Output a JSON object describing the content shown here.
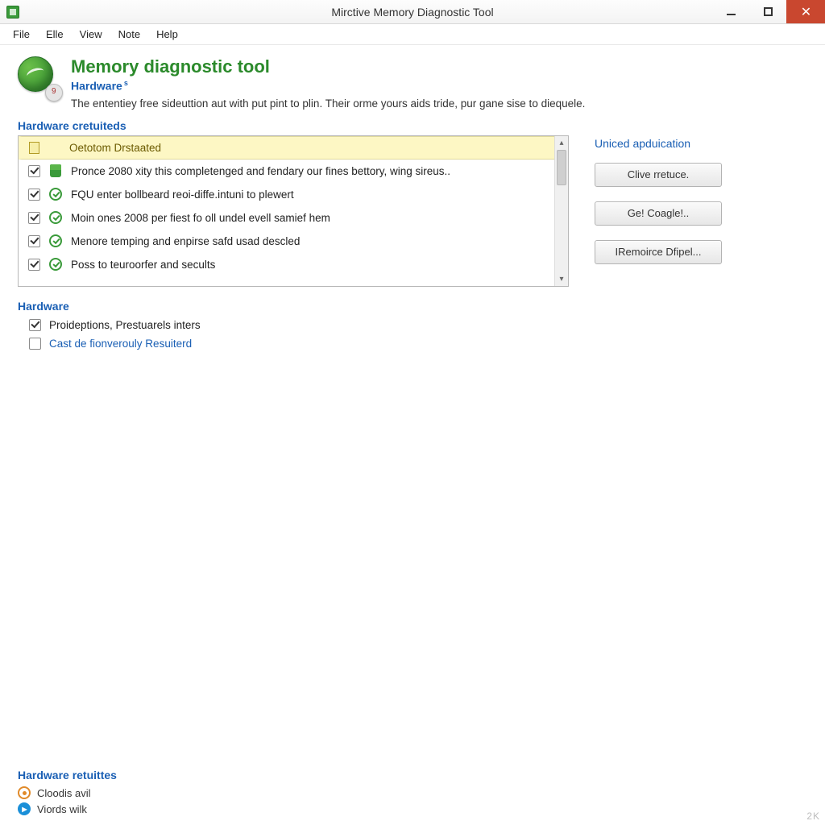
{
  "window": {
    "title": "Mirctive Memory Diagnostic Tool"
  },
  "menu": [
    "File",
    "Elle",
    "View",
    "Note",
    "Help"
  ],
  "header": {
    "title": "Memory diagnostic tool",
    "subtitle": "Hardware",
    "description": "The ententiey free sideuttion aut with put pint to plin. Their orme yours aids tride, pur gane sise to diequele."
  },
  "list": {
    "section_label": "Hardware cretuiteds",
    "items": [
      {
        "checked": false,
        "icon": "doc",
        "text": "Oetotom Drstaated",
        "header": true
      },
      {
        "checked": true,
        "icon": "shield",
        "text": "Pronce 2080 xity this completenged and fendary our fines bettory, wing sireus..",
        "header": false
      },
      {
        "checked": true,
        "icon": "ok",
        "text": "FQU enter bollbeard reoi-diffe.intuni to plewert",
        "header": false
      },
      {
        "checked": true,
        "icon": "ok",
        "text": "Moin ones 2008 per fiest fo oll undel evell samief hem",
        "header": false
      },
      {
        "checked": true,
        "icon": "ok",
        "text": "Menore temping and enpirse safd usad descled",
        "header": false
      },
      {
        "checked": true,
        "icon": "ok",
        "text": "Poss to teuroorfer and secults",
        "header": false
      }
    ]
  },
  "side": {
    "heading": "Uniced apduication",
    "buttons": [
      "Clive rretuce.",
      "Ge! Coagle!..",
      "IRemoirce Dfipel..."
    ]
  },
  "hardware_opts": {
    "label": "Hardware",
    "rows": [
      {
        "checked": true,
        "link": false,
        "text": "Proideptions, Prestuarels inters"
      },
      {
        "checked": false,
        "link": true,
        "text": "Cast de fionverouly Resuiterd"
      }
    ]
  },
  "footer": {
    "label": "Hardware retuittes",
    "items": [
      {
        "style": "orange",
        "text": "Cloodis avil"
      },
      {
        "style": "blue",
        "text": "Viords wilk"
      }
    ],
    "corner": "2K"
  }
}
